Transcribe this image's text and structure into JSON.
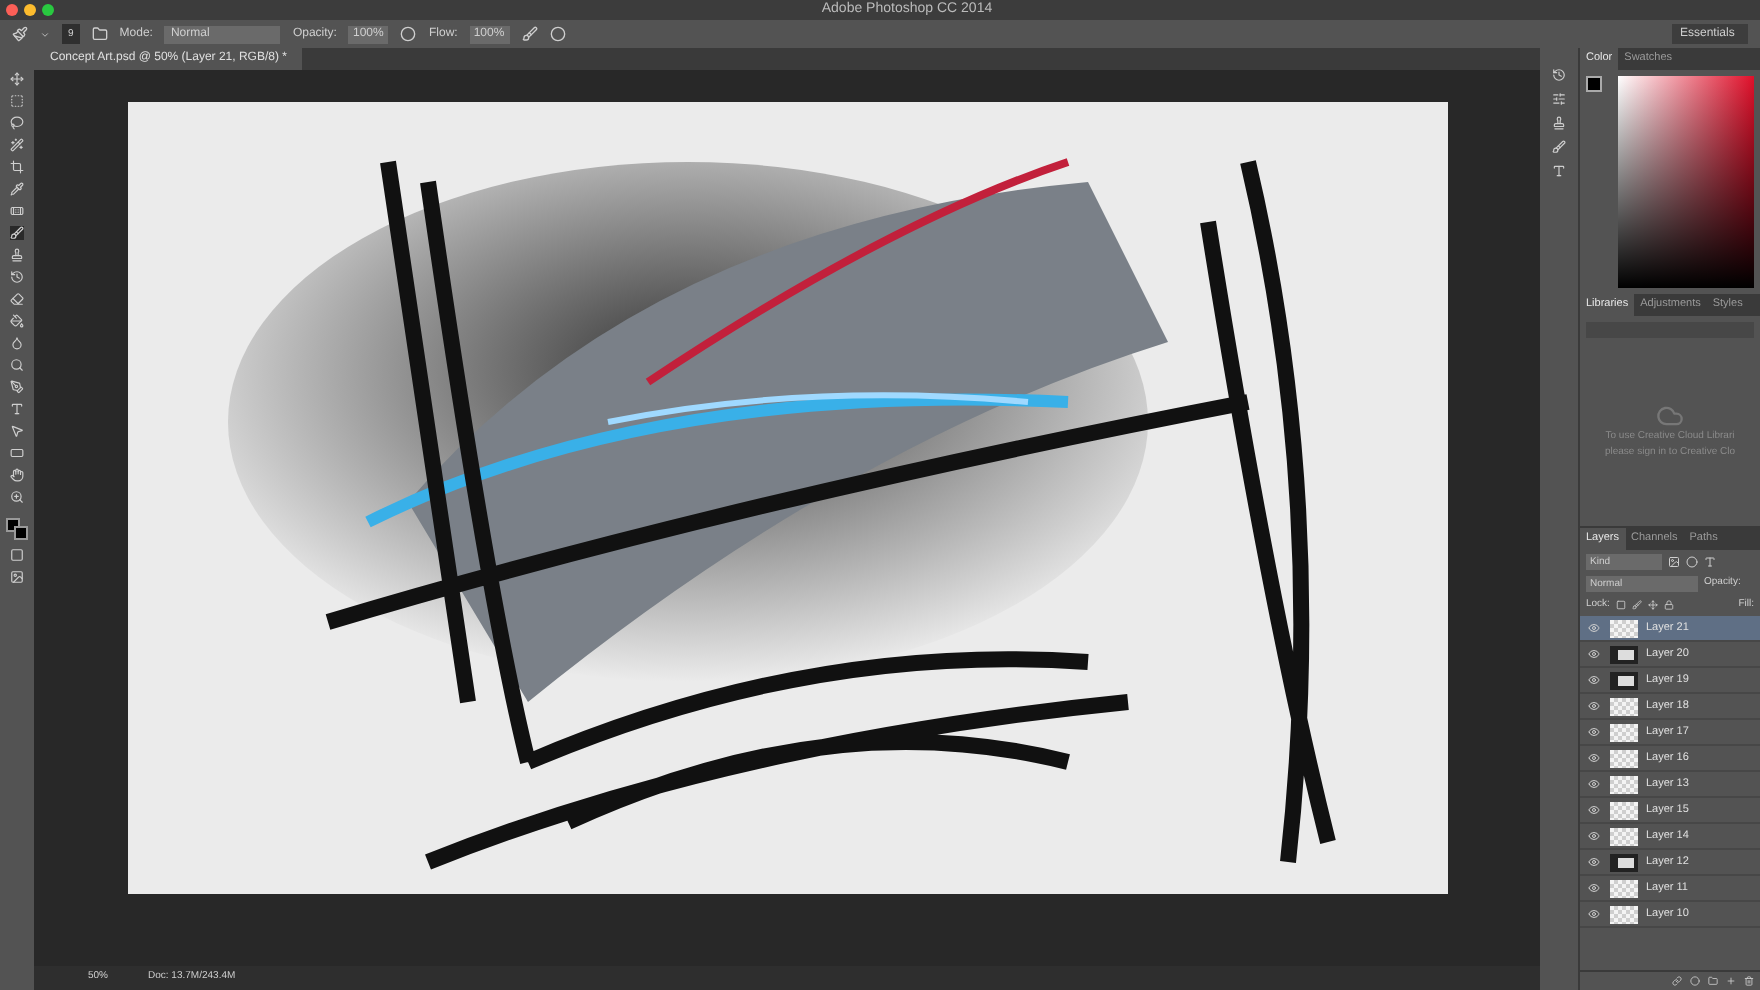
{
  "window": {
    "title": "Adobe Photoshop CC 2014"
  },
  "options_bar": {
    "brush_size": "9",
    "mode_label": "Mode:",
    "mode": "Normal",
    "opacity_label": "Opacity:",
    "opacity": "100%",
    "flow_label": "Flow:",
    "flow": "100%",
    "workspace": "Essentials"
  },
  "document_tab": {
    "title": "Concept Art.psd @ 50% (Layer 21, RGB/8) *"
  },
  "status_bar": {
    "zoom": "50%",
    "doc": "Doc: 13.7M/243.4M"
  },
  "color_panel": {
    "tabs": [
      {
        "label": "Color",
        "selected": true
      },
      {
        "label": "Swatches",
        "selected": false
      }
    ]
  },
  "libraries_panel": {
    "tabs": [
      {
        "label": "Libraries",
        "selected": true
      },
      {
        "label": "Adjustments",
        "selected": false
      },
      {
        "label": "Styles",
        "selected": false
      }
    ],
    "message_lines": [
      "To use Creative Cloud Librari",
      "please sign in to Creative Clo"
    ]
  },
  "layers_panel": {
    "tabs": [
      {
        "label": "Layers",
        "selected": true
      },
      {
        "label": "Channels",
        "selected": false
      },
      {
        "label": "Paths",
        "selected": false
      }
    ],
    "filter": "Kind",
    "blend_mode": "Normal",
    "opacity_label": "Opacity:",
    "lock_label": "Lock:",
    "fill_label": "Fill:",
    "layers": [
      {
        "name": "Layer 21",
        "selected": true,
        "visible": true,
        "kind": "blank"
      },
      {
        "name": "Layer 20",
        "selected": false,
        "visible": true,
        "kind": "sketch"
      },
      {
        "name": "Layer 19",
        "selected": false,
        "visible": true,
        "kind": "sketch"
      },
      {
        "name": "Layer 18",
        "selected": false,
        "visible": true,
        "kind": "blank"
      },
      {
        "name": "Layer 17",
        "selected": false,
        "visible": true,
        "kind": "blank"
      },
      {
        "name": "Layer 16",
        "selected": false,
        "visible": true,
        "kind": "blank"
      },
      {
        "name": "Layer 13",
        "selected": false,
        "visible": true,
        "kind": "blank"
      },
      {
        "name": "Layer 15",
        "selected": false,
        "visible": true,
        "kind": "blank"
      },
      {
        "name": "Layer 14",
        "selected": false,
        "visible": true,
        "kind": "blank"
      },
      {
        "name": "Layer 12",
        "selected": false,
        "visible": true,
        "kind": "sketch"
      },
      {
        "name": "Layer 11",
        "selected": false,
        "visible": true,
        "kind": "blank"
      },
      {
        "name": "Layer 10",
        "selected": false,
        "visible": true,
        "kind": "blank"
      }
    ]
  }
}
